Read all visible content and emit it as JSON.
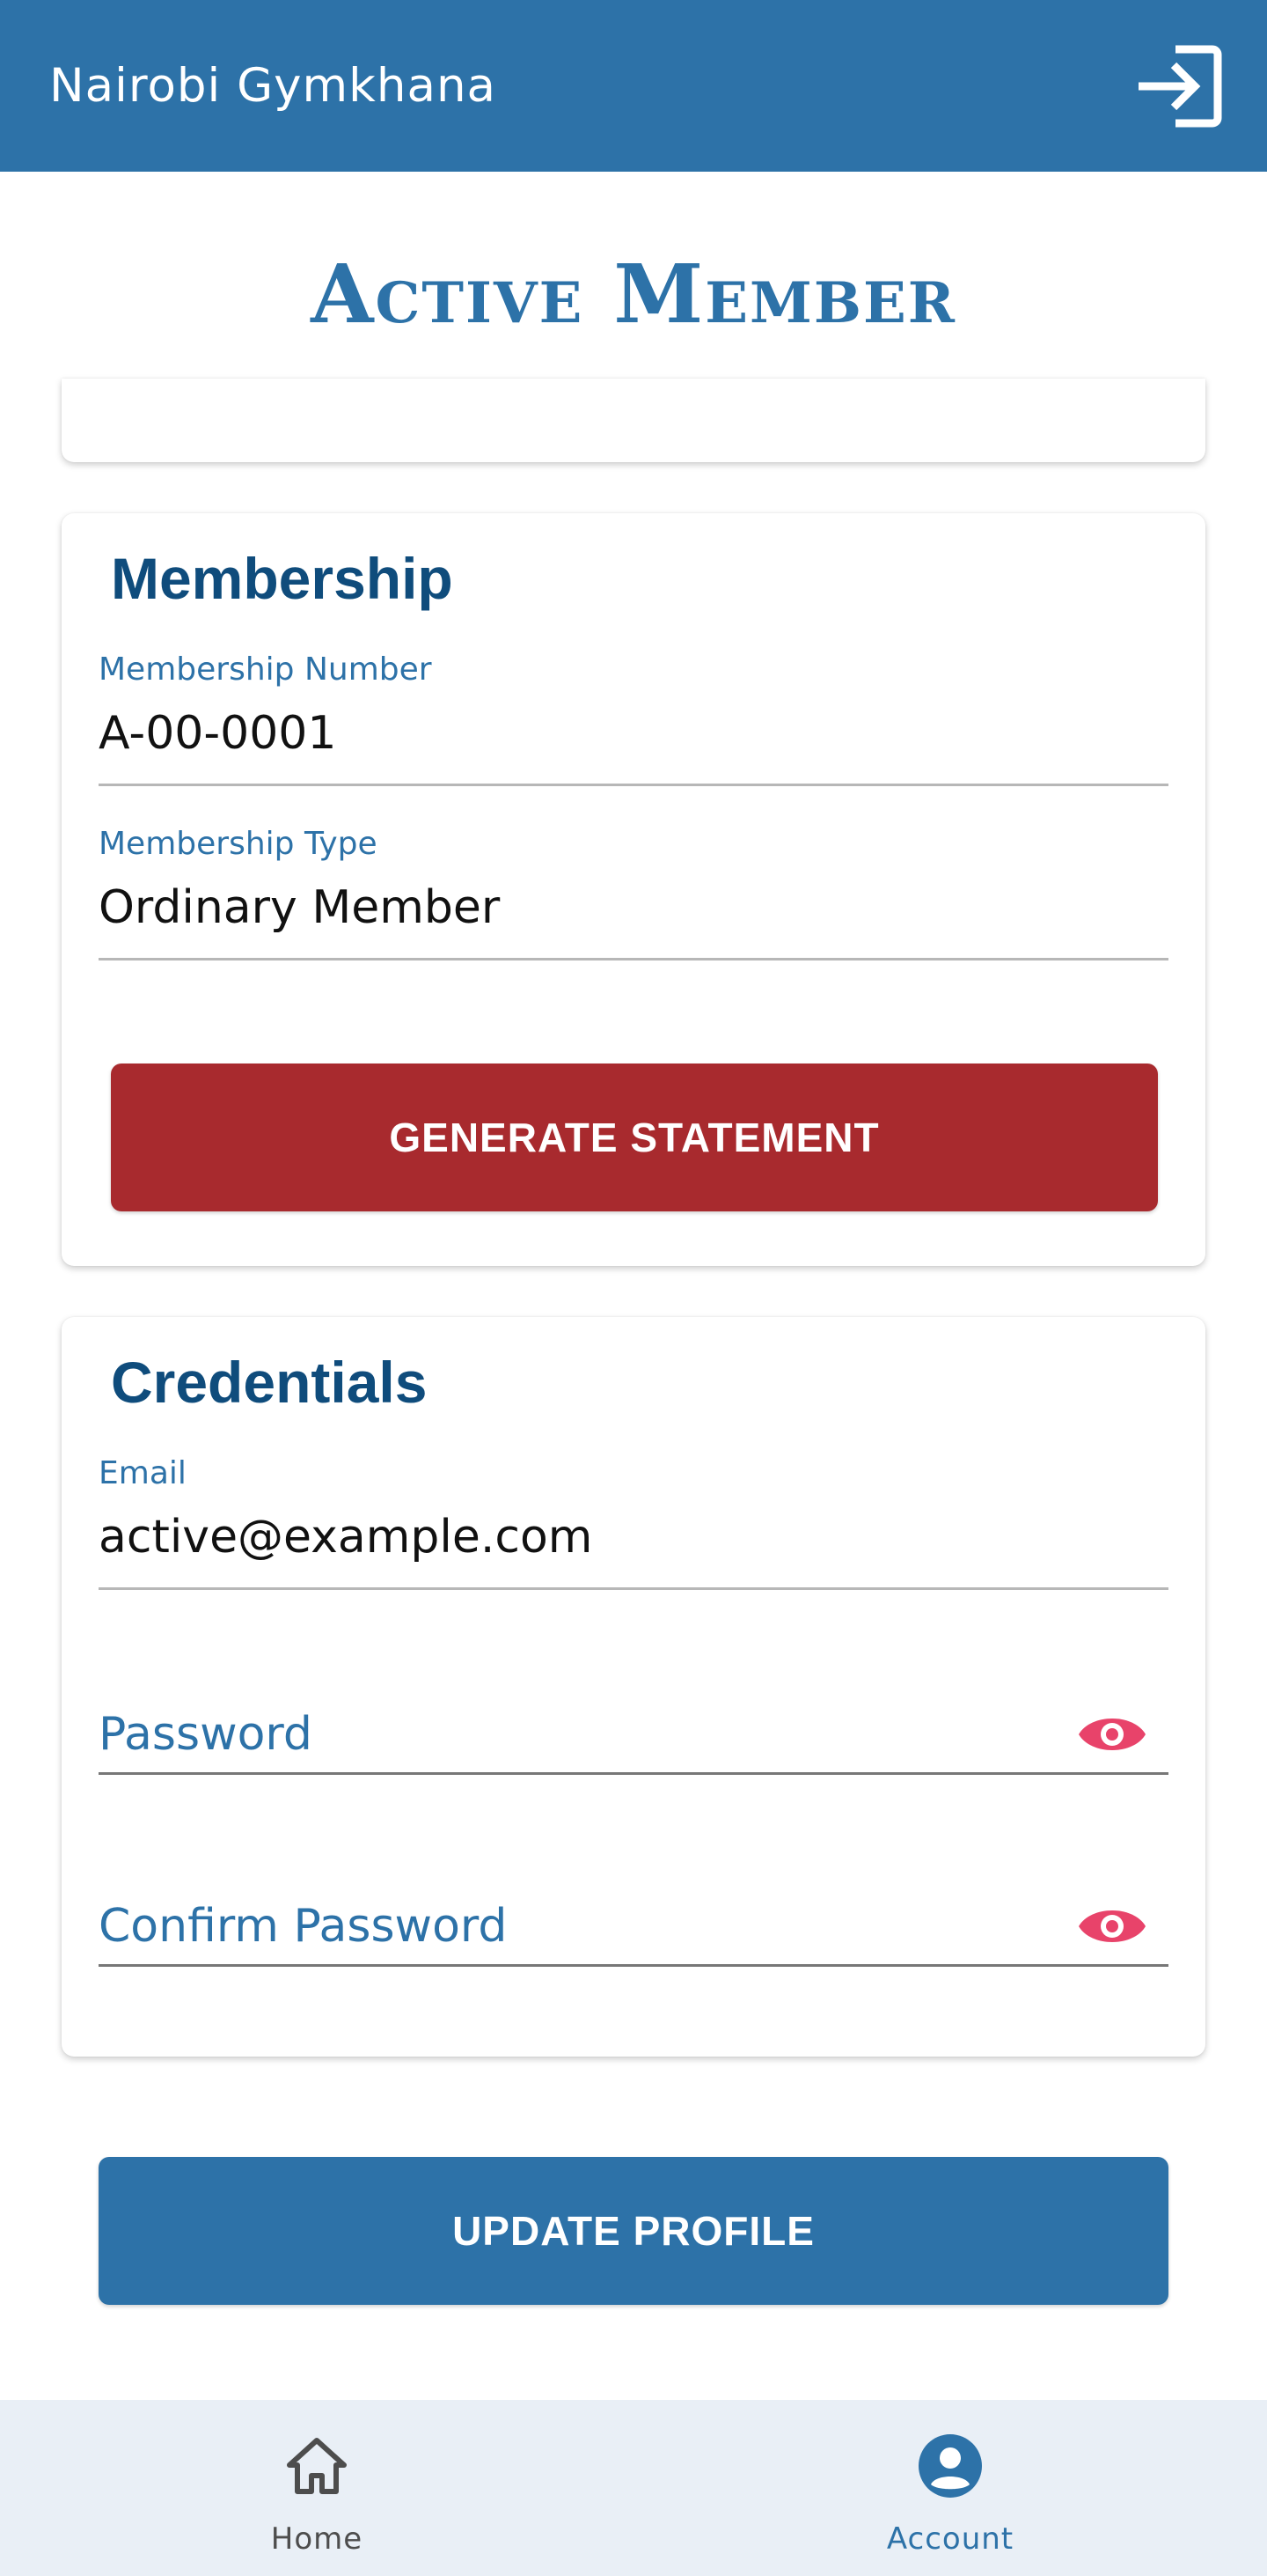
{
  "appbar": {
    "title": "Nairobi Gymkhana",
    "login_icon": "login-arrow-icon"
  },
  "page": {
    "title": "Active Member"
  },
  "membership": {
    "heading": "Membership",
    "number_label": "Membership Number",
    "number_value": "A-00-0001",
    "type_label": "Membership Type",
    "type_value": "Ordinary Member",
    "generate_button": "GENERATE STATEMENT"
  },
  "credentials": {
    "heading": "Credentials",
    "email_label": "Email",
    "email_value": "active@example.com",
    "password_placeholder": "Password",
    "confirm_password_placeholder": "Confirm Password",
    "visibility_icon": "eye-icon"
  },
  "actions": {
    "update_button": "UPDATE PROFILE"
  },
  "bottom_nav": {
    "items": [
      {
        "label": "Home",
        "icon": "home-icon",
        "active": false
      },
      {
        "label": "Account",
        "icon": "account-circle-icon",
        "active": true
      }
    ]
  },
  "colors": {
    "primary": "#2d72a8",
    "heading": "#0f4c7c",
    "danger_button": "#a82a2e",
    "eye_icon": "#e8436a",
    "nav_background": "#e9eff6"
  }
}
